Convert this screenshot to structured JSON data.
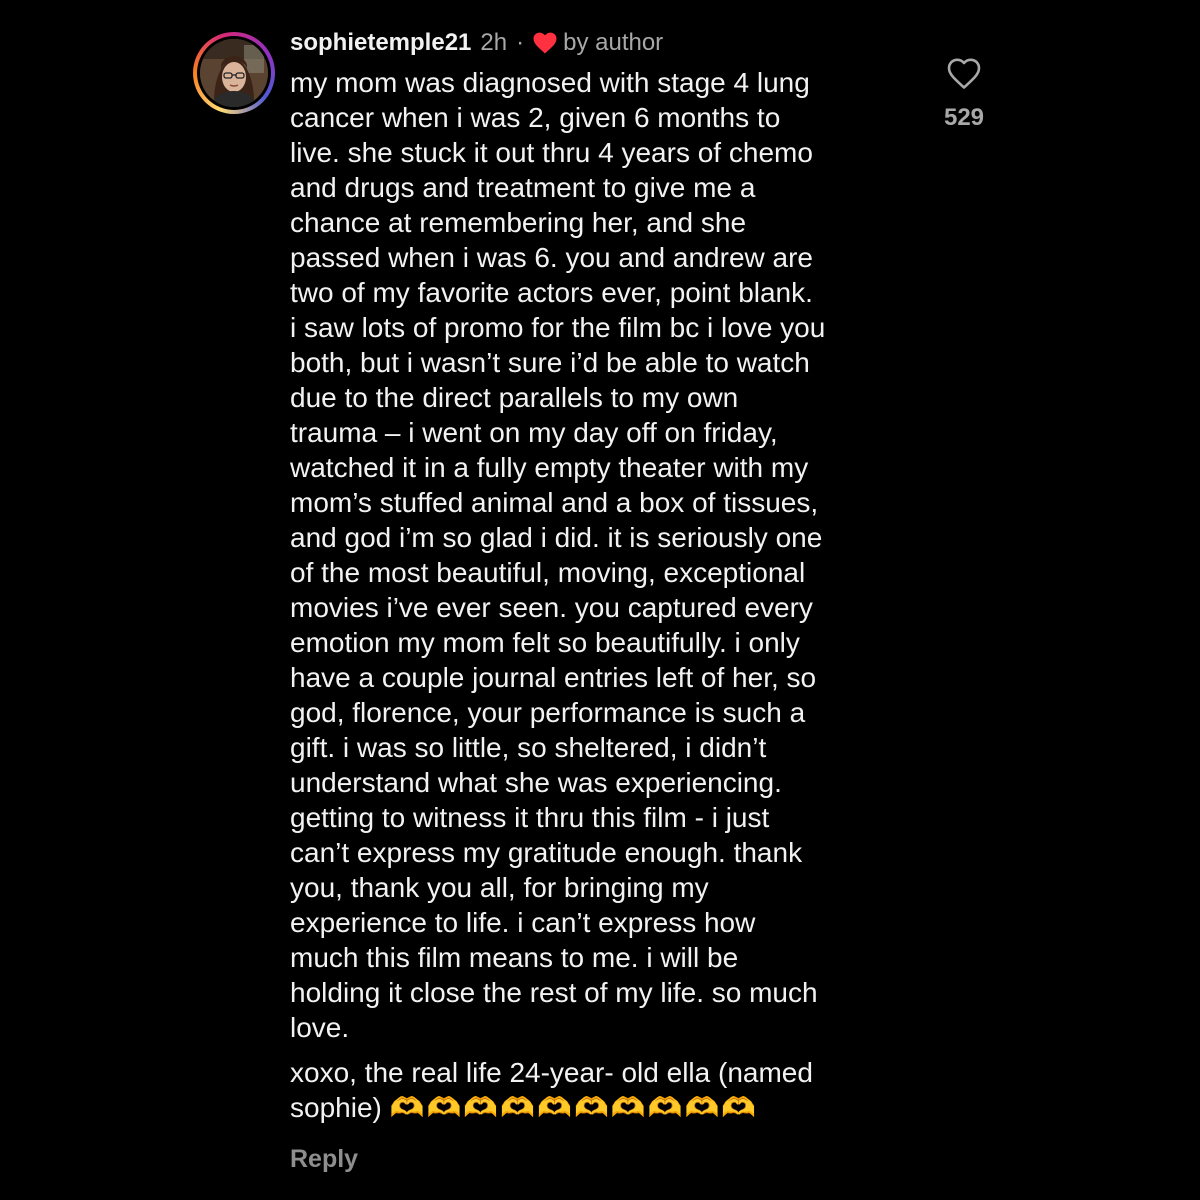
{
  "comment": {
    "username": "sophietemple21",
    "time": "2h",
    "separator": "·",
    "author_badge": "by author",
    "text": "my mom was diagnosed with stage 4 lung\ncancer when i was 2, given 6 months to\nlive. she stuck it out thru 4 years of chemo\nand drugs and treatment to give me a\nchance at remembering her, and she\npassed when i was 6. you and andrew are\ntwo of my favorite actors ever, point blank.\ni saw lots of promo for the film bc i love you\nboth, but i wasn’t sure i’d be able to watch\ndue to the direct parallels to my own\ntrauma – i went on my day off on friday,\nwatched it in a fully empty theater with my\nmom’s stuffed animal and a box of tissues,\nand god i’m so glad i did. it is seriously one\nof the most beautiful, moving, exceptional\nmovies i’ve ever seen. you captured every\nemotion my mom felt so beautifully. i only\nhave a couple journal entries left of her, so\ngod, florence, your performance is such a\ngift. i was so little, so sheltered, i didn’t\nunderstand what she was experiencing.\ngetting to witness it thru this film - i just\ncan’t express my gratitude enough. thank\nyou, thank you all, for bringing my\nexperience to life. i can’t express how\nmuch this film means to me. i will be\nholding it close the rest of my life. so much\nlove.",
    "signoff": "xoxo, the real life 24-year- old ella (named\nsophie) ",
    "emojis": "🫶🫶🫶🫶🫶🫶🫶🫶🫶🫶",
    "reply_label": "Reply",
    "like_count": "529"
  },
  "icons": {
    "author_heart": "heart-filled-icon",
    "like": "heart-outline-icon",
    "avatar": "profile-avatar"
  },
  "colors": {
    "background": "#000000",
    "text": "#f2f2f2",
    "muted": "#a8a8a8",
    "author_heart": "#ff3040",
    "reply": "#8e8e8e"
  }
}
